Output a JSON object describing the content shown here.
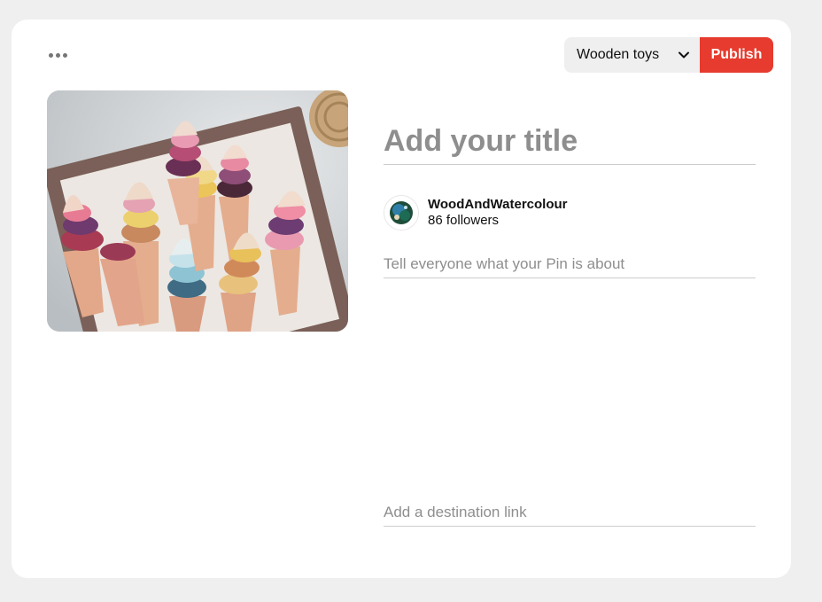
{
  "toolbar": {
    "more_icon": "more-horizontal-icon",
    "board_select": {
      "selected": "Wooden toys",
      "icon": "chevron-down-icon"
    },
    "publish_label": "Publish",
    "publish_color": "#e63b2e"
  },
  "pin": {
    "image_alt": "Wooden ice cream cone toys in a wooden box",
    "title_placeholder": "Add your title",
    "title_value": "",
    "description_placeholder": "Tell everyone what your Pin is about",
    "description_value": "",
    "link_placeholder": "Add a destination link",
    "link_value": ""
  },
  "profile": {
    "name": "WoodAndWatercolour",
    "followers": "86 followers"
  }
}
